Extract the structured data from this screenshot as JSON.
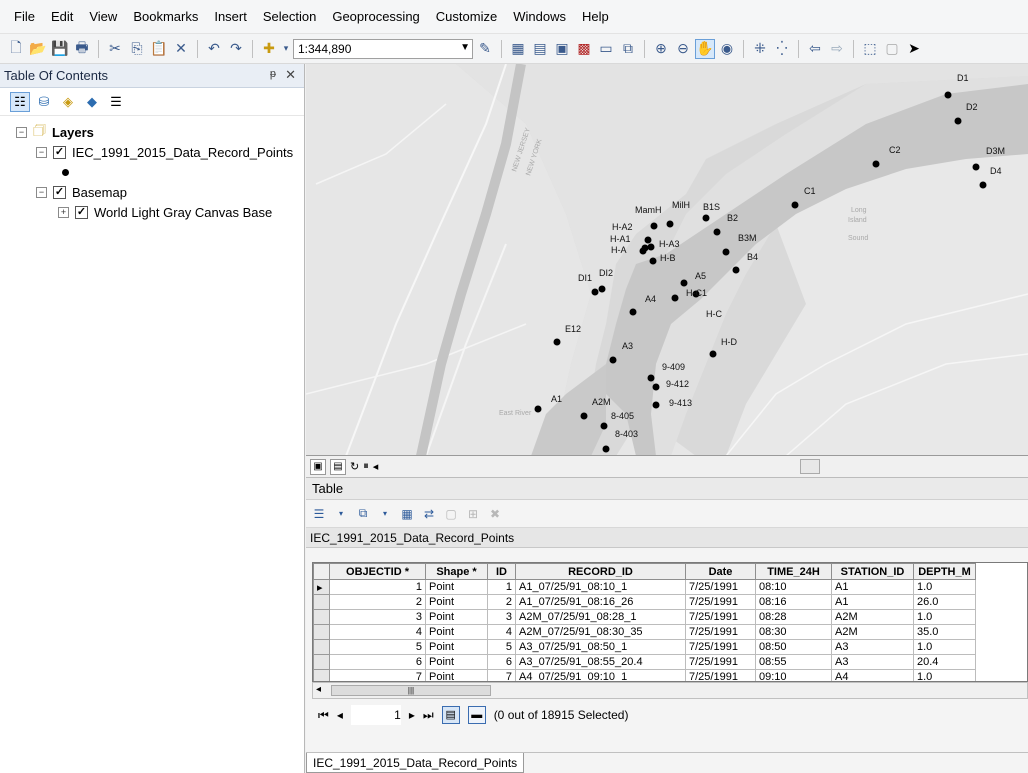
{
  "menu": [
    "File",
    "Edit",
    "View",
    "Bookmarks",
    "Insert",
    "Selection",
    "Geoprocessing",
    "Customize",
    "Windows",
    "Help"
  ],
  "toolbar": {
    "scale": "1:344,890"
  },
  "toc": {
    "title": "Table Of Contents",
    "pin": "ᵽ",
    "close": "✕",
    "root_label": "Layers",
    "layer1_label": "IEC_1991_2015_Data_Record_Points",
    "layer2_label": "Basemap",
    "layer2_child_label": "World Light Gray Canvas Base"
  },
  "map": {
    "stations": [
      "D1",
      "D2",
      "C2",
      "D3M",
      "D4",
      "C1",
      "MamH",
      "MilH",
      "B1S",
      "B2",
      "H-A2",
      "H-A1",
      "H-A3",
      "H-A",
      "H-B",
      "B3M",
      "B4",
      "DI1",
      "DI2",
      "A5",
      "A4",
      "H-C1",
      "H-C",
      "E12",
      "H-D",
      "A3",
      "9-409",
      "9-412",
      "A1",
      "A2M",
      "9-413",
      "8-405",
      "8-403"
    ],
    "basemap_labels": [
      "Long",
      "Island",
      "Sound",
      "NEW JERSEY",
      "NEW YORK",
      "East River"
    ]
  },
  "table": {
    "panel_title": "Table",
    "layer_name": "IEC_1991_2015_Data_Record_Points",
    "columns": [
      "OBJECTID *",
      "Shape *",
      "ID",
      "RECORD_ID",
      "Date",
      "TIME_24H",
      "STATION_ID",
      "DEPTH_M"
    ],
    "rows": [
      [
        "1",
        "Point",
        "1",
        "A1_07/25/91_08:10_1",
        "7/25/1991",
        "08:10",
        "A1",
        "1.0"
      ],
      [
        "2",
        "Point",
        "2",
        "A1_07/25/91_08:16_26",
        "7/25/1991",
        "08:16",
        "A1",
        "26.0"
      ],
      [
        "3",
        "Point",
        "3",
        "A2M_07/25/91_08:28_1",
        "7/25/1991",
        "08:28",
        "A2M",
        "1.0"
      ],
      [
        "4",
        "Point",
        "4",
        "A2M_07/25/91_08:30_35",
        "7/25/1991",
        "08:30",
        "A2M",
        "35.0"
      ],
      [
        "5",
        "Point",
        "5",
        "A3_07/25/91_08:50_1",
        "7/25/1991",
        "08:50",
        "A3",
        "1.0"
      ],
      [
        "6",
        "Point",
        "6",
        "A3_07/25/91_08:55_20.4",
        "7/25/1991",
        "08:55",
        "A3",
        "20.4"
      ],
      [
        "7",
        "Point",
        "7",
        "A4_07/25/91_09:10_1",
        "7/25/1991",
        "09:10",
        "A4",
        "1.0"
      ]
    ],
    "record_number": "1",
    "selection_status": "(0 out of 18915 Selected)",
    "tab_label": "IEC_1991_2015_Data_Record_Points"
  }
}
